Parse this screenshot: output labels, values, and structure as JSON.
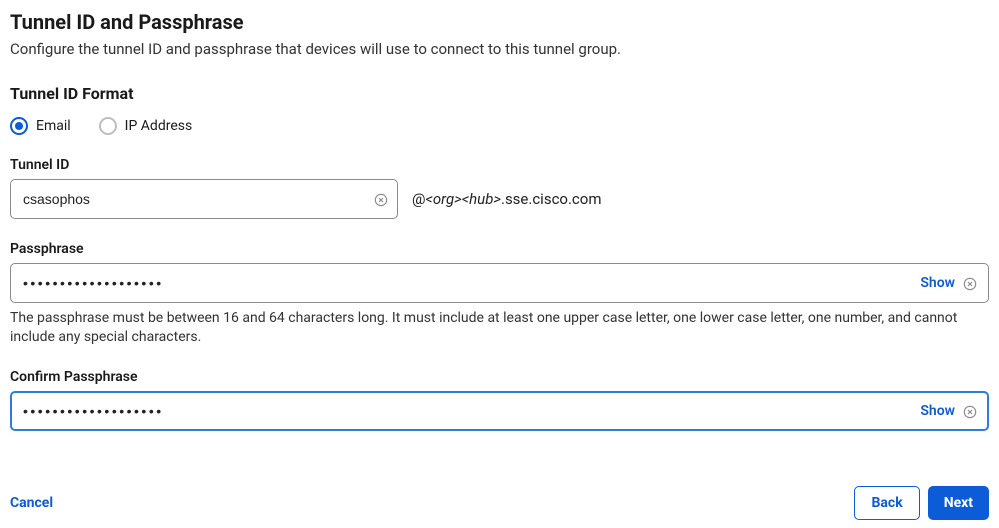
{
  "header": {
    "title": "Tunnel ID and Passphrase",
    "subtitle": "Configure the tunnel ID and passphrase that devices will use to connect to this tunnel group."
  },
  "format": {
    "section_label": "Tunnel ID Format",
    "options": [
      {
        "label": "Email",
        "checked": true
      },
      {
        "label": "IP Address",
        "checked": false
      }
    ]
  },
  "tunnel_id": {
    "label": "Tunnel ID",
    "value": "csasophos",
    "suffix_prefix": "@",
    "suffix_org": "<org>",
    "suffix_hub": "<hub>",
    "suffix_rest": ".sse.cisco.com"
  },
  "passphrase": {
    "label": "Passphrase",
    "masked": "•••••••••••••••••••",
    "show_label": "Show",
    "helper": "The passphrase must be between 16 and 64 characters long. It must include at least one upper case letter, one lower case letter, one number, and cannot include any special characters."
  },
  "confirm": {
    "label": "Confirm Passphrase",
    "masked": "•••••••••••••••••••",
    "show_label": "Show"
  },
  "footer": {
    "cancel": "Cancel",
    "back": "Back",
    "next": "Next"
  }
}
